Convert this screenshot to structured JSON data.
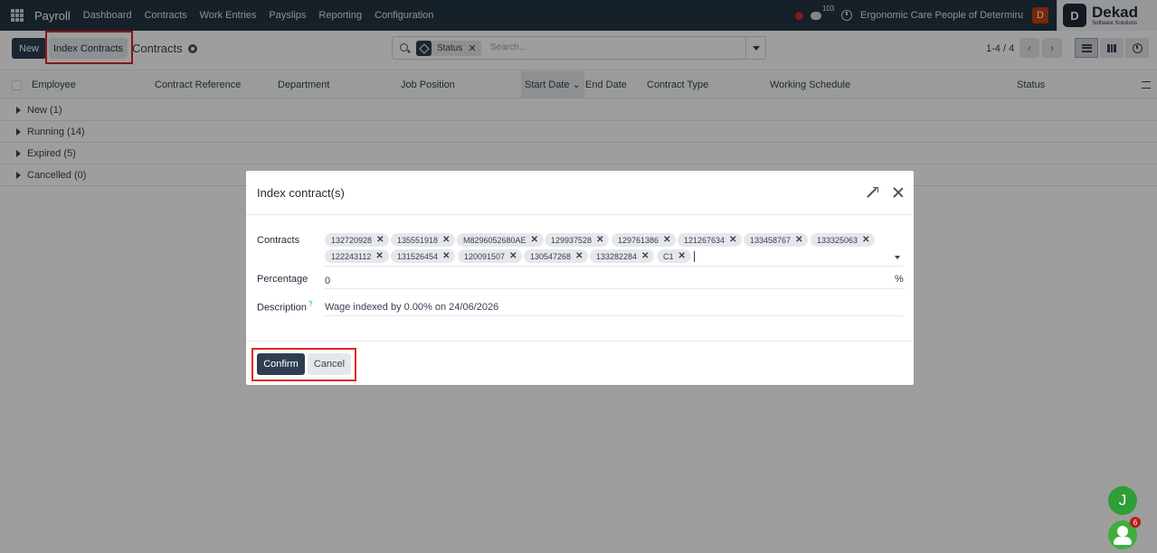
{
  "navbar": {
    "app_name": "Payroll",
    "menu": [
      "Dashboard",
      "Contracts",
      "Work Entries",
      "Payslips",
      "Reporting",
      "Configuration"
    ],
    "message_count": "103",
    "company": "Ergonomic Care People of Determina...",
    "user_initial": "D",
    "brand_mark": "D",
    "brand_name": "Dekad",
    "brand_tagline": "Software Solutions"
  },
  "control_panel": {
    "new_label": "New",
    "index_label": "Index Contracts",
    "breadcrumb": "Contracts",
    "facet_label": "Status",
    "facet_remove": "✕",
    "search_placeholder": "Search...",
    "pager": "1-4 / 4",
    "prev": "‹",
    "next": "›"
  },
  "list": {
    "columns": [
      "Employee",
      "Contract Reference",
      "Department",
      "Job Position",
      "Start Date",
      "End Date",
      "Contract Type",
      "Working Schedule",
      "Status"
    ],
    "groups": [
      "New (1)",
      "Running (14)",
      "Expired (5)",
      "Cancelled (0)"
    ]
  },
  "modal": {
    "title": "Index contract(s)",
    "contracts_label": "Contracts",
    "contracts": [
      "132720928",
      "135551918",
      "M8296052680AE",
      "129937528",
      "129761386",
      "121267634",
      "133458767",
      "133325063",
      "122243112",
      "131526454",
      "120091507",
      "130547268",
      "133282284",
      "C1"
    ],
    "tag_remove": "✕",
    "percentage_label": "Percentage",
    "percentage_value": "0",
    "percentage_suffix": "%",
    "description_label": "Description",
    "description_help": "?",
    "description_value": "Wage indexed by 0.00% on 24/06/2026",
    "confirm_label": "Confirm",
    "cancel_label": "Cancel"
  },
  "chat": {
    "bubble_initial": "J",
    "group_badge": "6"
  },
  "colors": {
    "navbar": "#243543",
    "primary": "#2c3e50",
    "highlight": "#dc2626"
  }
}
